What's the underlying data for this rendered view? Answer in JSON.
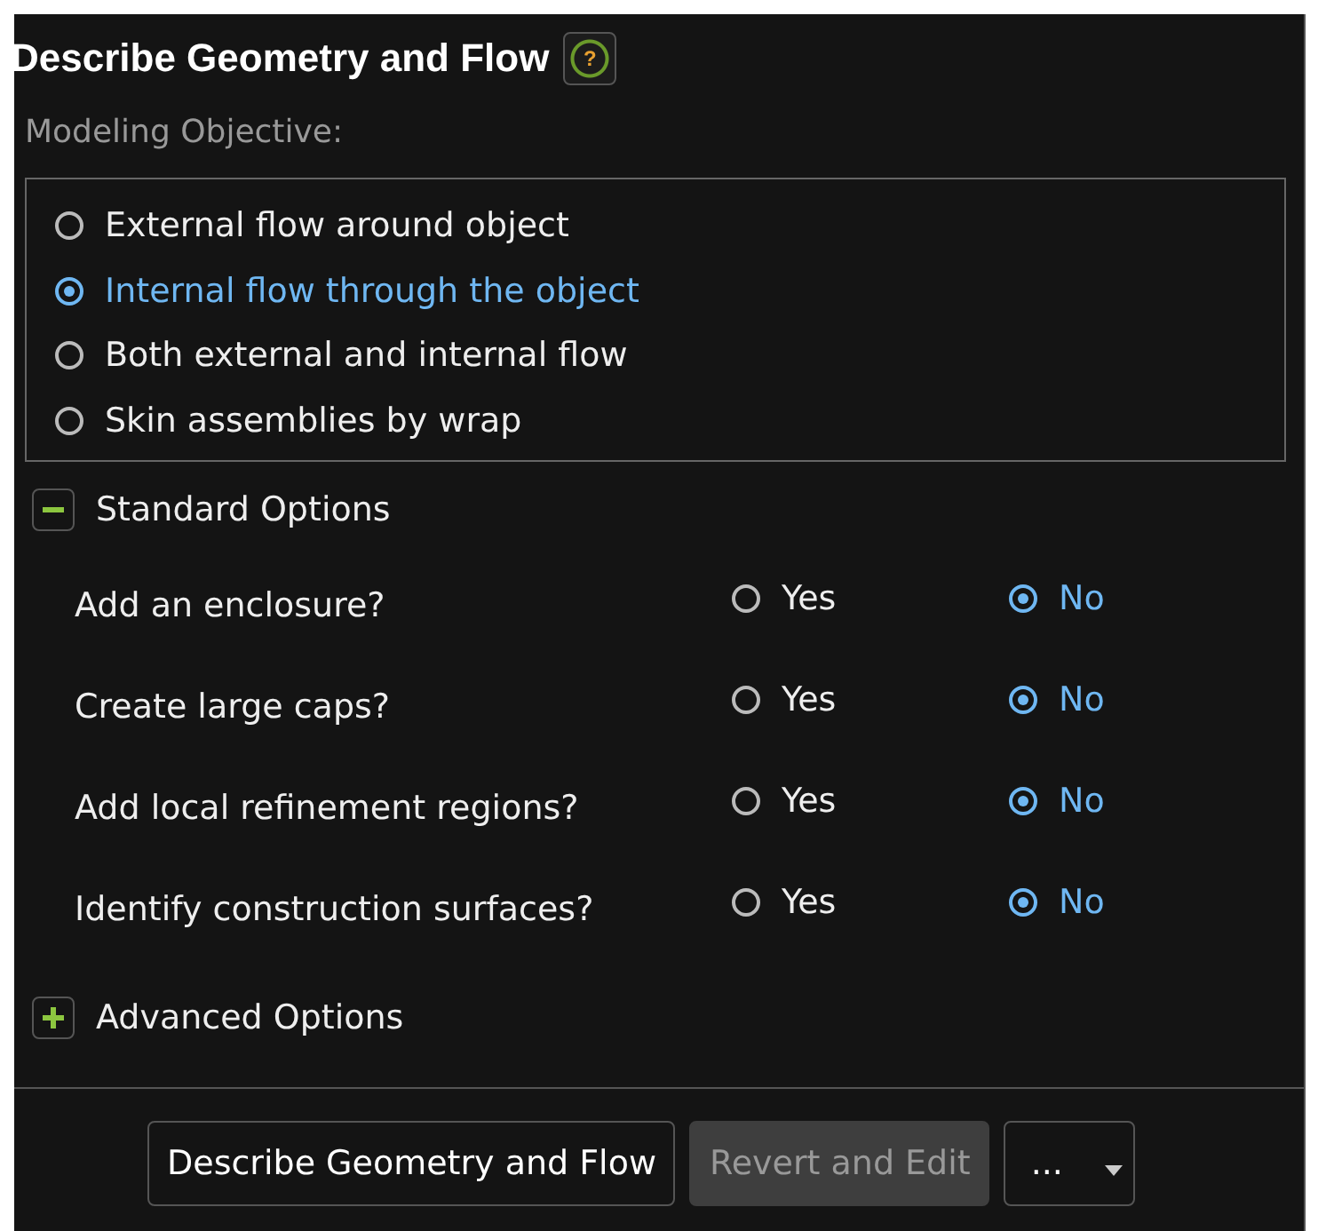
{
  "title": "Describe Geometry and Flow",
  "help": {
    "label": "?"
  },
  "objective": {
    "label": "Modeling Objective:",
    "options": [
      {
        "label": "External flow around object",
        "selected": false
      },
      {
        "label": "Internal flow through the object",
        "selected": true
      },
      {
        "label": "Both external and internal flow",
        "selected": false
      },
      {
        "label": "Skin assemblies by wrap",
        "selected": false
      }
    ]
  },
  "sections": [
    {
      "label": "Standard Options",
      "expanded": true,
      "questions": [
        {
          "label": "Add an enclosure?",
          "options": [
            {
              "label": "Yes",
              "selected": false
            },
            {
              "label": "No",
              "selected": true
            }
          ]
        },
        {
          "label": "Create large caps?",
          "options": [
            {
              "label": "Yes",
              "selected": false
            },
            {
              "label": "No",
              "selected": true
            }
          ]
        },
        {
          "label": "Add local refinement regions?",
          "options": [
            {
              "label": "Yes",
              "selected": false
            },
            {
              "label": "No",
              "selected": true
            }
          ]
        },
        {
          "label": "Identify construction surfaces?",
          "options": [
            {
              "label": "Yes",
              "selected": false
            },
            {
              "label": "No",
              "selected": true
            }
          ]
        }
      ]
    },
    {
      "label": "Advanced Options",
      "expanded": false
    }
  ],
  "buttons": [
    {
      "label": "Describe Geometry and Flow",
      "disabled": false,
      "kind": "button"
    },
    {
      "label": "Revert and Edit",
      "disabled": true,
      "kind": "button"
    },
    {
      "label": "...",
      "disabled": false,
      "kind": "dropdown"
    }
  ]
}
